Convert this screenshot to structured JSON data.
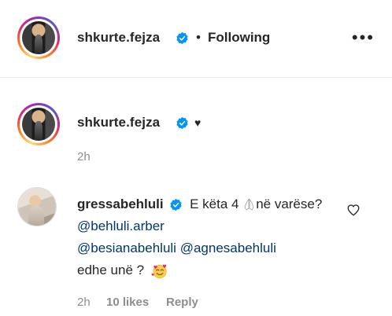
{
  "header": {
    "username": "shkurte.fejza",
    "separator": "•",
    "follow_status": "Following",
    "more_label": "•••"
  },
  "caption": {
    "username": "shkurte.fejza",
    "text": "♥",
    "time": "2h"
  },
  "comment": {
    "username": "gressabehluli",
    "text_before": "E këta 4",
    "text_after": "në varëse?",
    "mentions": [
      "@behluli.arber",
      "@besianabehluli",
      "@agnesabehluli"
    ],
    "text_end": "edhe unë ?",
    "time": "2h",
    "likes": "10 likes",
    "reply_label": "Reply"
  },
  "colors": {
    "text": "#262626",
    "muted": "#8e8e8e",
    "mention": "#00376b",
    "verified": "#0095f6"
  },
  "icons": [
    "verified-badge-icon",
    "more-options-icon",
    "heart-outline-icon",
    "praying-hands-emoji",
    "smiling-hearts-emoji"
  ]
}
